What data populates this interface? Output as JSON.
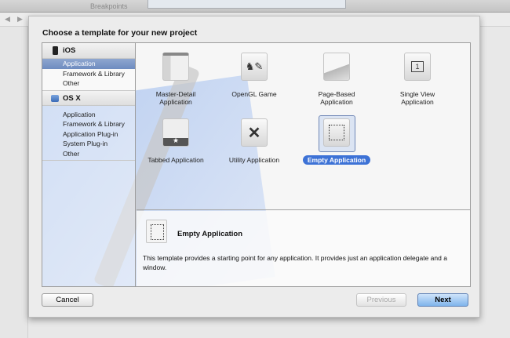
{
  "toolbar": {
    "breakpoints_label": "Breakpoints",
    "back": "◀",
    "forward": "▶"
  },
  "dialog": {
    "title": "Choose a template for your new project"
  },
  "sidebar": {
    "sections": [
      {
        "label": "iOS",
        "items": [
          "Application",
          "Framework & Library",
          "Other"
        ],
        "selected": "Application"
      },
      {
        "label": "OS X",
        "items": [
          "Application",
          "Framework & Library",
          "Application Plug-in",
          "System Plug-in",
          "Other"
        ]
      }
    ]
  },
  "templates": [
    {
      "label1": "Master-Detail",
      "label2": "Application",
      "icon": "master-detail-icon"
    },
    {
      "label1": "OpenGL Game",
      "label2": "",
      "icon": "opengl-game-icon",
      "glyph": "♞✎"
    },
    {
      "label1": "Page-Based",
      "label2": "Application",
      "icon": "page-based-icon"
    },
    {
      "label1": "Single View",
      "label2": "Application",
      "icon": "single-view-icon",
      "glyph": "1"
    },
    {
      "label1": "Tabbed Application",
      "label2": "",
      "icon": "tabbed-icon",
      "glyph": "★"
    },
    {
      "label1": "Utility Application",
      "label2": "",
      "icon": "utility-icon",
      "glyph": "✕"
    },
    {
      "label1": "Empty Application",
      "label2": "",
      "icon": "empty-app-icon",
      "selected": true
    }
  ],
  "description": {
    "title": "Empty Application",
    "text": "This template provides a starting point for any application. It provides just an application delegate and a window."
  },
  "buttons": {
    "cancel": "Cancel",
    "previous": "Previous",
    "next": "Next"
  }
}
